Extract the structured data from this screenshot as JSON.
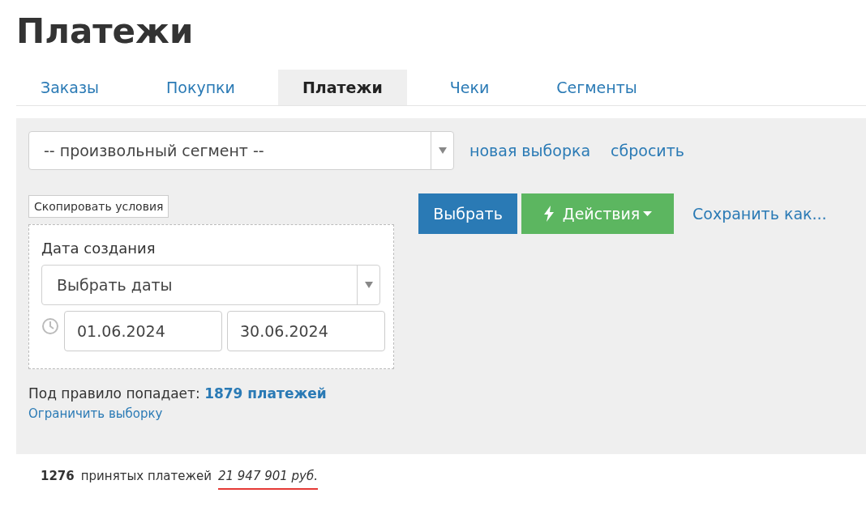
{
  "title": "Платежи",
  "tabs": [
    {
      "label": "Заказы",
      "selected": false
    },
    {
      "label": "Покупки",
      "selected": false
    },
    {
      "label": "Платежи",
      "selected": true
    },
    {
      "label": "Чеки",
      "selected": false
    },
    {
      "label": "Сегменты",
      "selected": false
    }
  ],
  "segment_select": {
    "value": "-- произвольный сегмент --"
  },
  "segment_links": [
    "новая выборка",
    "сбросить"
  ],
  "copy_button": "Скопировать условия",
  "condition": {
    "label": "Дата создания",
    "select_value": "Выбрать даты",
    "date_from": "01.06.2024",
    "date_to": "30.06.2024"
  },
  "actions": {
    "select_button": "Выбрать",
    "actions_button": "Действия",
    "save_link": "Сохранить как..."
  },
  "match": {
    "label": "Под правило попадает:",
    "count_link": "1879 платежей",
    "limit_link": "Ограничить выборку"
  },
  "summary": {
    "count": "1276",
    "label": "принятых платежей",
    "amount": "21 947 901 руб."
  }
}
